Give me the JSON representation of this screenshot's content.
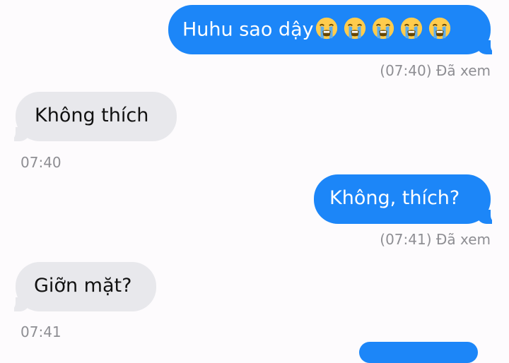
{
  "messages": [
    {
      "direction": "outgoing",
      "text": "Huhu sao dậy",
      "emoji": [
        "loudly-crying-face",
        "loudly-crying-face",
        "loudly-crying-face",
        "loudly-crying-face",
        "loudly-crying-face"
      ],
      "meta": "(07:40) Đã xem"
    },
    {
      "direction": "incoming",
      "text": "Không thích",
      "meta": "07:40"
    },
    {
      "direction": "outgoing",
      "text": "Không, thích?",
      "meta": "(07:41) Đã xem"
    },
    {
      "direction": "incoming",
      "text": "Giỡn mặt?",
      "meta": "07:41"
    }
  ],
  "colors": {
    "outgoing_bubble": "#1c86f8",
    "incoming_bubble": "#e8e8ec",
    "background": "#fdfbfd",
    "meta_text": "#8e8e93"
  }
}
